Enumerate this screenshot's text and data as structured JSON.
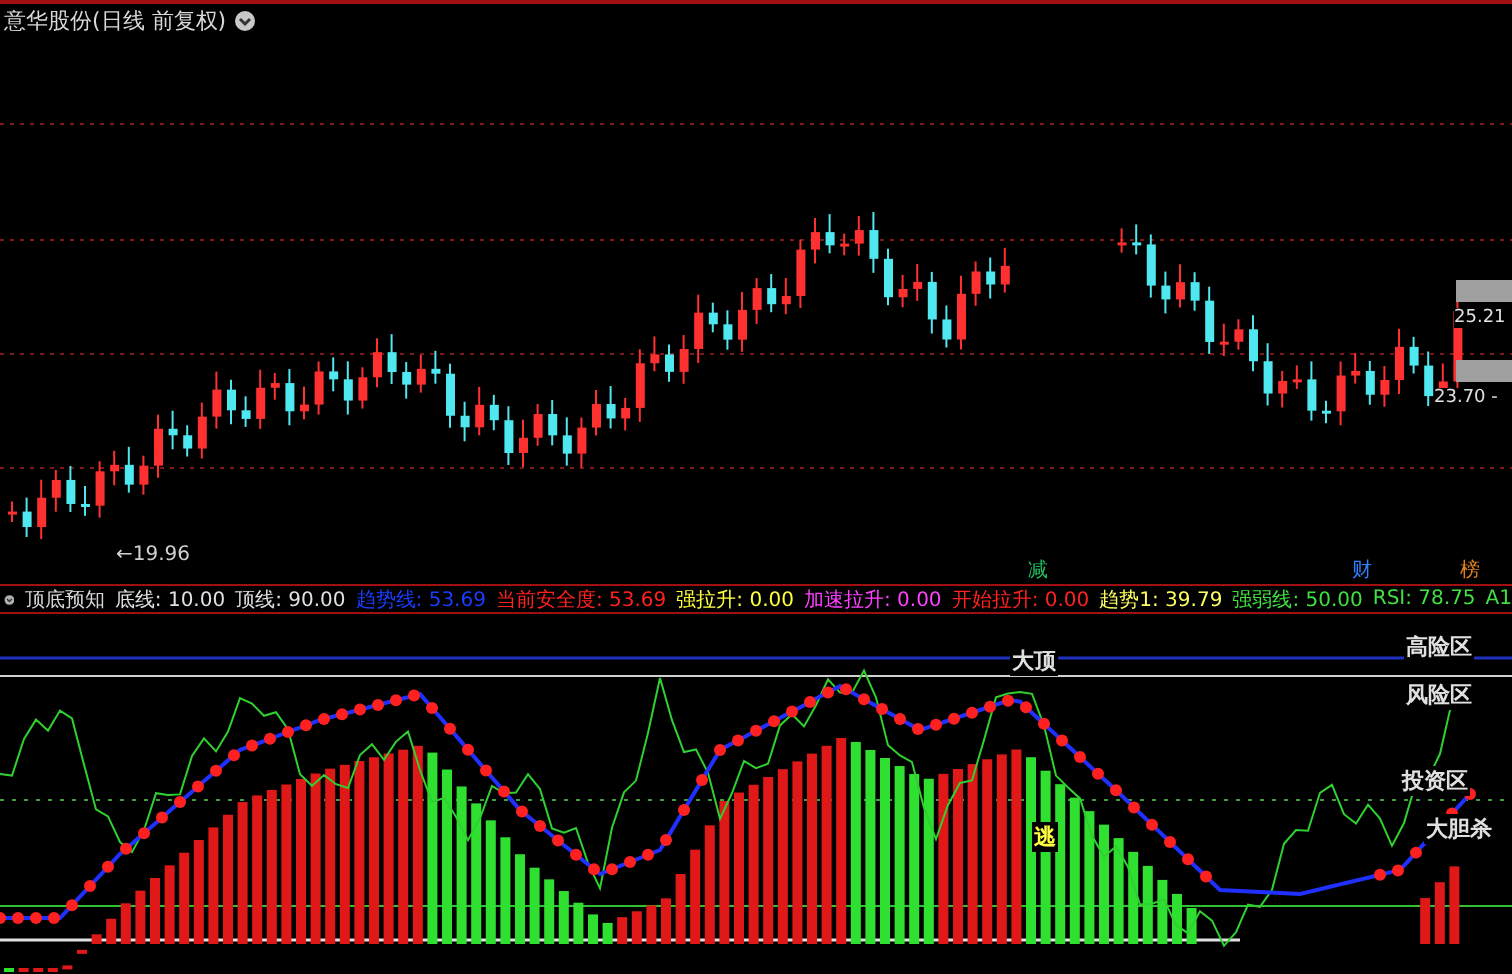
{
  "title": {
    "text": "意华股份(日线 前复权)"
  },
  "price_labels": [
    {
      "text": "25.21",
      "kind": "boxed"
    },
    {
      "text": "23.70 -",
      "kind": "boxed"
    },
    {
      "text": "←19.96",
      "kind": "plain"
    }
  ],
  "markers": [
    {
      "text": "减",
      "color": "#20c060"
    },
    {
      "text": "财",
      "color": "#3080ff"
    },
    {
      "text": "榜",
      "color": "#e08020"
    }
  ],
  "indicator": {
    "name": "顶底预知",
    "legend": [
      {
        "text": "底线: 10.00",
        "color": "#e0e0e0"
      },
      {
        "text": "顶线: 90.00",
        "color": "#e0e0e0"
      },
      {
        "text": "趋势线: 53.69",
        "color": "#1a3cff"
      },
      {
        "text": "当前安全度: 53.69",
        "color": "#ff2020"
      },
      {
        "text": "强拉升: 0.00",
        "color": "#ffff40"
      },
      {
        "text": "加速拉升: 0.00",
        "color": "#ff40ff"
      },
      {
        "text": "开始拉升: 0.00",
        "color": "#ff2020"
      },
      {
        "text": "趋势1: 39.79",
        "color": "#ffff60"
      },
      {
        "text": "强弱线: 50.00",
        "color": "#40e040"
      },
      {
        "text": "RSI: 78.75",
        "color": "#40e040"
      },
      {
        "text": "A1",
        "color": "#40e040"
      }
    ]
  },
  "zone_labels": [
    {
      "text": "高险区",
      "kind": "zone"
    },
    {
      "text": "风险区",
      "kind": "zone"
    },
    {
      "text": "大顶",
      "kind": "zone"
    },
    {
      "text": "逃",
      "kind": "signal"
    },
    {
      "text": "投资区",
      "kind": "zone"
    },
    {
      "text": "大胆杀",
      "kind": "zone"
    }
  ]
}
